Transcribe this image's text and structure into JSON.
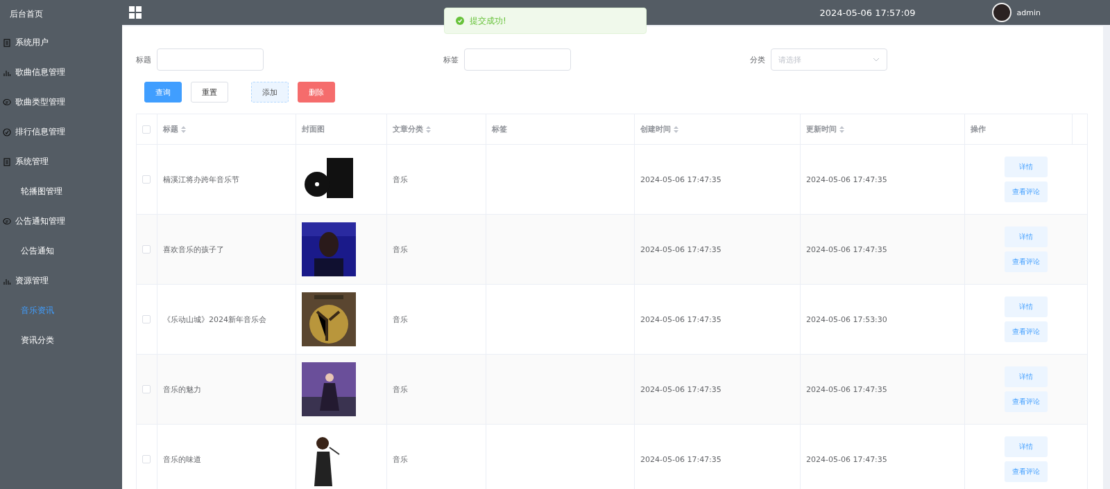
{
  "sidebar": {
    "title": "后台首页",
    "items": [
      {
        "label": "系统用户",
        "selected": false
      },
      {
        "label": "歌曲信息管理",
        "selected": false
      },
      {
        "label": "歌曲类型管理",
        "selected": false
      },
      {
        "label": "排行信息管理",
        "selected": false
      },
      {
        "label": "系统管理",
        "selected": false,
        "children": [
          {
            "label": "轮播图管理",
            "selected": false
          }
        ]
      },
      {
        "label": "公告通知管理",
        "selected": false,
        "children": [
          {
            "label": "公告通知",
            "selected": false
          }
        ]
      },
      {
        "label": "资源管理",
        "selected": false,
        "children": [
          {
            "label": "音乐资讯",
            "selected": true
          },
          {
            "label": "资讯分类",
            "selected": false
          }
        ]
      }
    ]
  },
  "header": {
    "datetime": "2024-05-06 17:57:09",
    "user": "admin"
  },
  "toast": {
    "message": "提交成功!"
  },
  "filters": [
    {
      "label": "标题",
      "kind": "text"
    },
    {
      "label": "标签",
      "kind": "text"
    },
    {
      "label": "分类",
      "kind": "select",
      "placeholder": "请选择"
    }
  ],
  "buttons": [
    {
      "label": "查询",
      "kind": "primary"
    },
    {
      "label": "重置",
      "kind": "default"
    },
    {
      "label": "添加",
      "kind": "light"
    },
    {
      "label": "删除",
      "kind": "danger"
    }
  ],
  "table": {
    "all_checked": false,
    "columns": [
      {
        "label": "标题",
        "sortable": true
      },
      {
        "label": "封面图",
        "sortable": false
      },
      {
        "label": "文章分类",
        "sortable": true
      },
      {
        "label": "标签",
        "sortable": false
      },
      {
        "label": "创建时间",
        "sortable": true
      },
      {
        "label": "更新时间",
        "sortable": true
      },
      {
        "label": "操作",
        "sortable": false
      }
    ],
    "rows": [
      {
        "checked": false,
        "title": "楠溪江将办跨年音乐节",
        "category": "音乐",
        "created": "2024-05-06 17:47:35",
        "updated": "2024-05-06 17:47:35",
        "actions": [
          "详情",
          "查看评论"
        ]
      },
      {
        "checked": false,
        "title": "喜欢音乐的孩子了",
        "category": "音乐",
        "created": "2024-05-06 17:47:35",
        "updated": "2024-05-06 17:47:35",
        "actions": [
          "详情",
          "查看评论"
        ]
      },
      {
        "checked": false,
        "title": "《乐动山城》2024新年音乐会",
        "category": "音乐",
        "created": "2024-05-06 17:47:35",
        "updated": "2024-05-06 17:53:30",
        "actions": [
          "详情",
          "查看评论"
        ]
      },
      {
        "checked": false,
        "title": "音乐的魅力",
        "category": "音乐",
        "created": "2024-05-06 17:47:35",
        "updated": "2024-05-06 17:47:35",
        "actions": [
          "详情",
          "查看评论"
        ]
      },
      {
        "checked": false,
        "title": "音乐的味道",
        "category": "音乐",
        "created": "2024-05-06 17:47:35",
        "updated": "2024-05-06 17:47:35",
        "actions": [
          "详情",
          "查看评论"
        ]
      }
    ]
  }
}
